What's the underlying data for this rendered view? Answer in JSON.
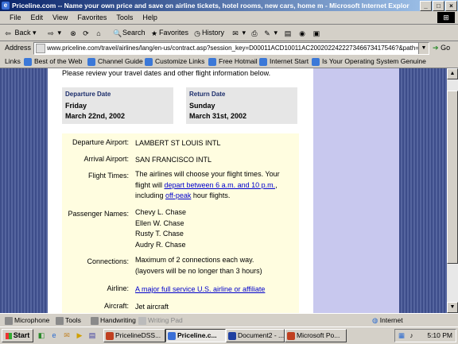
{
  "window": {
    "title": "Priceline.com -- Name your own price and save on airline tickets, hotel rooms, new cars, home m - Microsoft Internet Explorer",
    "controls": [
      "_",
      "□",
      "×"
    ]
  },
  "menu": [
    "File",
    "Edit",
    "View",
    "Favorites",
    "Tools",
    "Help"
  ],
  "toolbar": {
    "back": "Back",
    "search": "Search",
    "favorites": "Favorites",
    "history": "History"
  },
  "address": {
    "label": "Address",
    "url": "www.priceline.com/travel/airlines/lang/en-us/contract.asp?session_key=D00011ACD10011AC200202242227346673417546?&path=bak",
    "go": "Go"
  },
  "links": {
    "label": "Links",
    "items": [
      "Best of the Web",
      "Channel Guide",
      "Customize Links",
      "Free Hotmail",
      "Internet Start",
      "Is Your Operating System Genuine"
    ]
  },
  "page": {
    "intro": "Please review your travel dates and other flight information below.",
    "departure": {
      "label": "Departure Date",
      "day": "Friday",
      "date": "March 22nd, 2002"
    },
    "return": {
      "label": "Return Date",
      "day": "Sunday",
      "date": "March 31st, 2002"
    },
    "details": {
      "departure_airport": {
        "label": "Departure Airport:",
        "value": "LAMBERT ST LOUIS INTL"
      },
      "arrival_airport": {
        "label": "Arrival Airport:",
        "value": "SAN FRANCISCO INTL"
      },
      "flight_times": {
        "label": "Flight Times:",
        "text1": "The airlines will choose your flight times. Your flight will ",
        "link1": "depart between 6 a.m. and 10 p.m.",
        "text2": ", including ",
        "link2": "off-peak",
        "text3": " hour flights."
      },
      "passengers": {
        "label": "Passenger Names:",
        "names": [
          "Chevy L. Chase",
          "Ellen W. Chase",
          "Rusty T. Chase",
          "Audry R. Chase"
        ]
      },
      "connections": {
        "label": "Connections:",
        "line1": "Maximum of 2 connections each way.",
        "line2": "(layovers will be no longer than 3 hours)"
      },
      "airline": {
        "label": "Airline:",
        "link": "A major full service U.S. airline or affiliate"
      },
      "aircraft": {
        "label": "Aircraft:",
        "value": "Jet aircraft"
      }
    }
  },
  "langbar": {
    "microphone": "Microphone",
    "tools": "Tools",
    "handwriting": "Handwriting",
    "writing_pad": "Writing Pad",
    "zone": "Internet"
  },
  "taskbar": {
    "start": "Start",
    "tasks": [
      "PricelineDSS...",
      "Priceline.c...",
      "Document2 - ...",
      "Microsoft Po..."
    ],
    "clock": "5:10 PM"
  }
}
